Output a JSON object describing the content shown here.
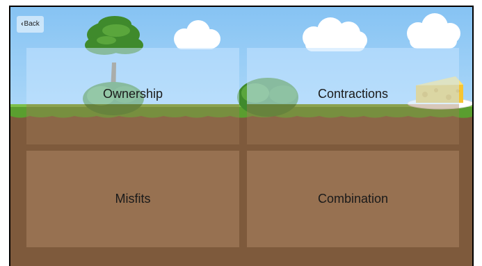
{
  "nav": {
    "back_label": "Back",
    "back_icon": "chevron-left-icon"
  },
  "menu": {
    "ownership": "Ownership",
    "contractions": "Contractions",
    "misfits": "Misfits",
    "combination": "Combination"
  },
  "colors": {
    "sky": "#8ec8f5",
    "grass": "#5a9e2f",
    "soil": "#7e5a3c",
    "tile_sky": "#c4e4ff",
    "tile_ground": "#a07a58"
  }
}
